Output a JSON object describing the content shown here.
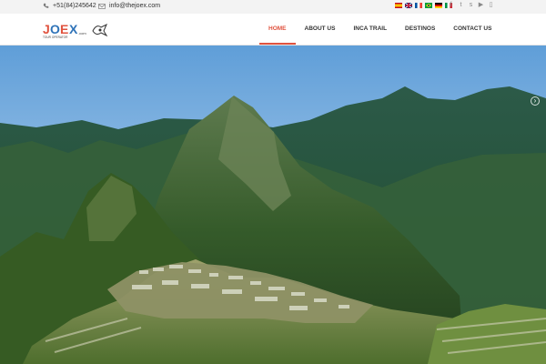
{
  "topbar": {
    "phone": "+51(84)245642",
    "email": "info@thejoex.com",
    "flags": [
      "es",
      "gb",
      "fr",
      "br",
      "de",
      "it"
    ],
    "social_icons": [
      "facebook-icon",
      "twitter-icon",
      "skype-icon",
      "youtube-icon",
      "mobile-icon"
    ]
  },
  "header": {
    "logo_text": "JOEX",
    "logo_sub": "TOUR OPERATOR",
    "logo_domain": ".com"
  },
  "nav": {
    "items": [
      "HOME",
      "ABOUT US",
      "INCA TRAIL",
      "DESTINOS",
      "CONTACT US"
    ],
    "active": "HOME"
  },
  "hero": {
    "subject": "Machu Picchu mountain landscape"
  },
  "colors": {
    "accent": "#e0533f",
    "topbar_bg": "#f3f3f3"
  }
}
